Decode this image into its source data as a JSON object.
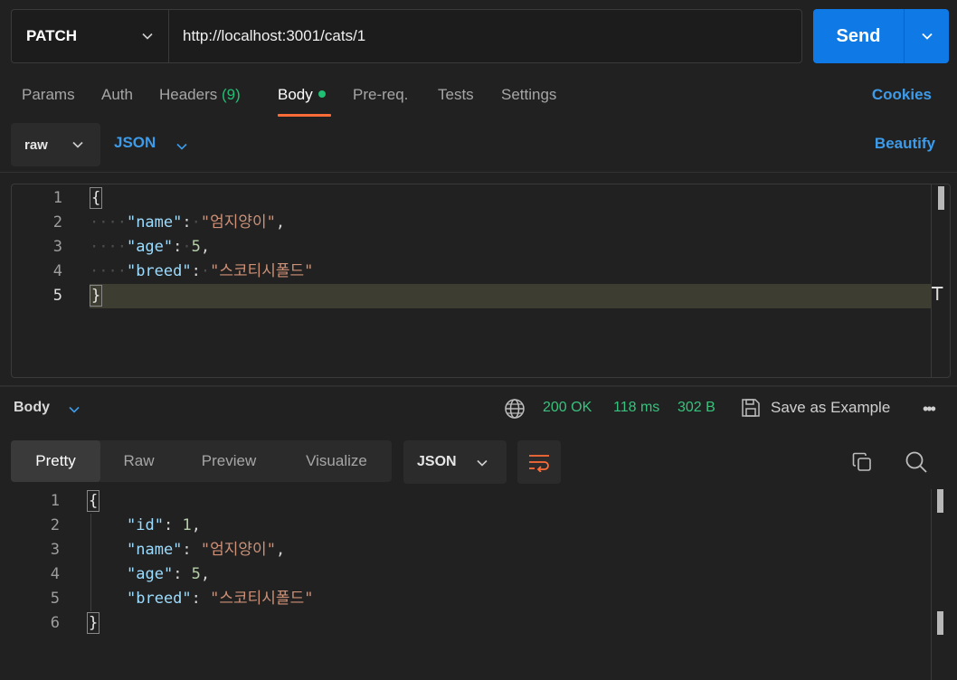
{
  "request": {
    "method": "PATCH",
    "url": "http://localhost:3001/cats/1",
    "send_label": "Send"
  },
  "tabs": {
    "params": "Params",
    "auth": "Auth",
    "headers": "Headers",
    "headers_count": "(9)",
    "body": "Body",
    "prereq": "Pre-req.",
    "tests": "Tests",
    "settings": "Settings",
    "cookies": "Cookies"
  },
  "body_toolbar": {
    "mode": "raw",
    "format": "JSON",
    "beautify": "Beautify"
  },
  "request_body": {
    "line_numbers": [
      "1",
      "2",
      "3",
      "4",
      "5"
    ],
    "open_brace": "{",
    "close_brace": "}",
    "fields": [
      {
        "key": "\"name\"",
        "value": "\"엄지양이\"",
        "type": "string"
      },
      {
        "key": "\"age\"",
        "value": "5",
        "type": "number"
      },
      {
        "key": "\"breed\"",
        "value": "\"스코티시폴드\"",
        "type": "string"
      }
    ]
  },
  "response_bar": {
    "section": "Body",
    "status": "200 OK",
    "time": "118 ms",
    "size": "302 B",
    "save_label": "Save as Example",
    "more": "•••"
  },
  "response_view": {
    "tabs": [
      "Pretty",
      "Raw",
      "Preview",
      "Visualize"
    ],
    "active_tab": "Pretty",
    "format": "JSON"
  },
  "response_body": {
    "line_numbers": [
      "1",
      "2",
      "3",
      "4",
      "5",
      "6"
    ],
    "open_brace": "{",
    "close_brace": "}",
    "fields": [
      {
        "key": "\"id\"",
        "value": "1",
        "type": "number"
      },
      {
        "key": "\"name\"",
        "value": "\"엄지양이\"",
        "type": "string"
      },
      {
        "key": "\"age\"",
        "value": "5",
        "type": "number"
      },
      {
        "key": "\"breed\"",
        "value": "\"스코티시폴드\"",
        "type": "string"
      }
    ]
  },
  "colors": {
    "accent": "#ff6c37",
    "send": "#0f7ae5",
    "link": "#3d9be9",
    "success": "#1fbf74"
  }
}
